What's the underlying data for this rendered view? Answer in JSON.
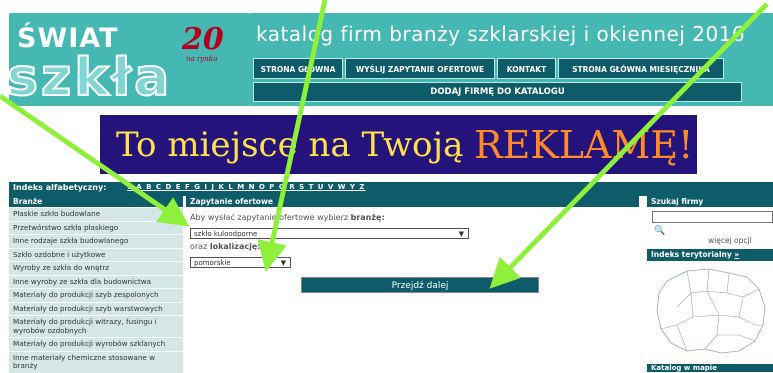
{
  "logo": {
    "line1": "ŚWIAT",
    "line2": "szkła",
    "anniv": "20",
    "anniv_sub": "na rynku"
  },
  "site_title": "katalog firm branży szklarskiej i okiennej 2016",
  "nav": [
    "STRONA GŁÓWNA",
    "WYŚLIJ ZAPYTANIE OFERTOWE",
    "KONTAKT",
    "STRONA GŁÓWNA MIESIĘCZNIKA"
  ],
  "add_firm": "DODAJ FIRMĘ DO KATALOGU",
  "banner": {
    "part1": "To miejsce na Twoją",
    "part2": "REKLAMĘ!"
  },
  "alpha": {
    "label": "Indeks alfabetyczny:",
    "letters": "1 A B C D E F G I J K L M N O P Q R S T U V W Y Z"
  },
  "categories": {
    "title": "Branże",
    "items": [
      "Płaskie szkło budowlane",
      "Przetwórstwo szkła płaskiego",
      "Inne rodzaje szkła budowlanego",
      "Szkło ozdobne i użytkowe",
      "Wyroby ze szkła do wnętrz",
      "Inne wyroby ze szkła dla budownictwa",
      "Materiały do produkcji szyb zespolonych",
      "Materiały do produkcji szyb warstwowych",
      "Materiały do produkcji witrazy, fusingu i wyrobów ozdobnych",
      "Materiały do produkcji wyrobów szklanych",
      "Inne materiały chemiczne stosowane w branży"
    ]
  },
  "inquiry": {
    "title": "Zapytanie ofertowe",
    "instruction": "Aby wysłać zapytanie ofertowe wybierz",
    "instruction_bold": "branżę:",
    "branch_value": "szkło kuloodporne",
    "location_prefix": "oraz",
    "location_label": "lokalizację:",
    "location_value": "pomorskie",
    "submit": "Przejdź dalej"
  },
  "search": {
    "title": "Szukaj firmy",
    "more": "więcej opcji"
  },
  "territorial": {
    "title": "Indeks terytorialny",
    "link": "»"
  },
  "map_box": {
    "title": "Katalog w mapie"
  },
  "colors": {
    "teal": "#45b8b4",
    "dark_teal": "#0e5b6a",
    "arrow": "#8ef03a",
    "banner_bg": "#23137a"
  }
}
